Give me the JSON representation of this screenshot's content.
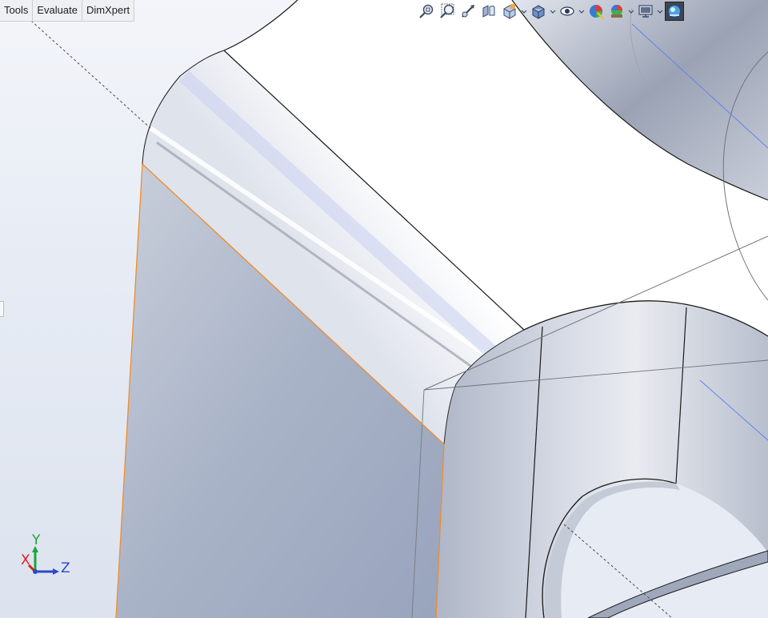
{
  "menu_tabs": [
    "Tools",
    "Evaluate",
    "DimXpert"
  ],
  "heads_up_toolbar": [
    {
      "icon": "zoom-to-fit-icon"
    },
    {
      "icon": "zoom-to-area-icon"
    },
    {
      "icon": "previous-view-icon"
    },
    {
      "icon": "section-view-icon"
    },
    {
      "icon": "view-orientation-icon"
    },
    {
      "icon": "display-style-icon"
    },
    {
      "icon": "hide-show-items-icon"
    },
    {
      "icon": "edit-appearance-icon"
    },
    {
      "icon": "apply-scene-icon"
    },
    {
      "icon": "view-settings-icon"
    },
    {
      "icon": "realview-graphics-icon"
    }
  ],
  "triad": {
    "x_label": "X",
    "y_label": "Y",
    "z_label": "Z"
  },
  "colors": {
    "background": "#e6ebf4",
    "model_face": "#b8c4dc",
    "model_top": "#ffffff",
    "edge": "#1a1a1a",
    "selected_edge": "#f08c2a",
    "axis_x": "#d62020",
    "axis_y": "#18a83c",
    "axis_z": "#2a48c8"
  }
}
